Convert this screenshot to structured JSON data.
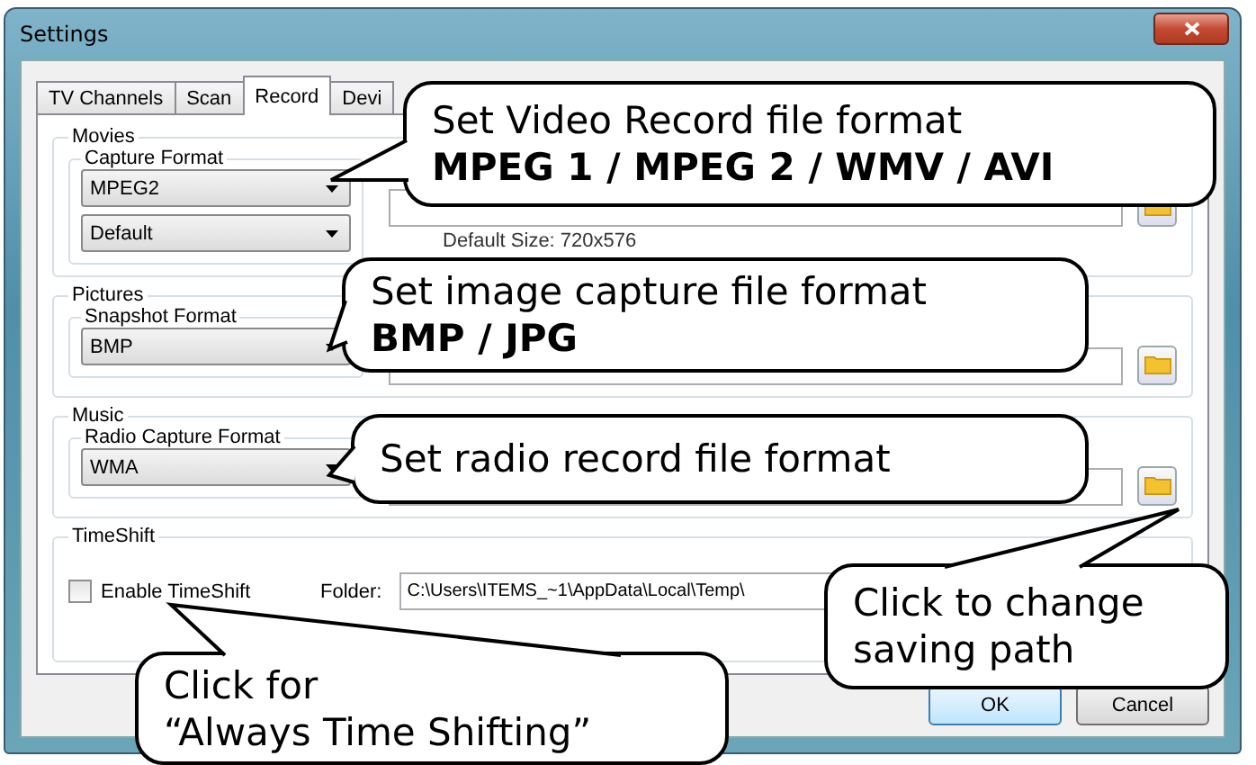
{
  "window": {
    "title": "Settings"
  },
  "tabs": [
    {
      "label": "TV Channels",
      "selected": false
    },
    {
      "label": "Scan",
      "selected": false
    },
    {
      "label": "Record",
      "selected": true
    },
    {
      "label": "Devi",
      "selected": false
    }
  ],
  "groups": [
    {
      "title": "Movies",
      "format_group": "Capture Format",
      "dropdowns": [
        "MPEG2",
        "Default"
      ],
      "note": "Default Size: 720x576"
    },
    {
      "title": "Pictures",
      "format_group": "Snapshot Format",
      "dropdowns": [
        "BMP"
      ]
    },
    {
      "title": "Music",
      "format_group": "Radio Capture Format",
      "dropdowns": [
        "WMA"
      ]
    }
  ],
  "timeshift": {
    "title": "TimeShift",
    "checkbox": {
      "label": "Enable TimeShift",
      "checked": false
    },
    "folder_label": "Folder:",
    "folder": "C:\\Users\\ITEMS_~1\\AppData\\Local\\Temp\\"
  },
  "buttons": [
    "OK",
    "Cancel"
  ],
  "callouts": [
    {
      "lines": [
        "Set Video Record file format"
      ],
      "formats": "MPEG 1 / MPEG 2 / WMV / AVI"
    },
    {
      "lines": [
        "Set image capture file format"
      ],
      "formats": "BMP / JPG"
    },
    {
      "lines": [
        "Set radio record file format"
      ]
    },
    {
      "lines": [
        "Click to change",
        "saving path"
      ]
    },
    {
      "lines": [
        "Click for",
        "“Always Time Shifting”"
      ]
    }
  ]
}
